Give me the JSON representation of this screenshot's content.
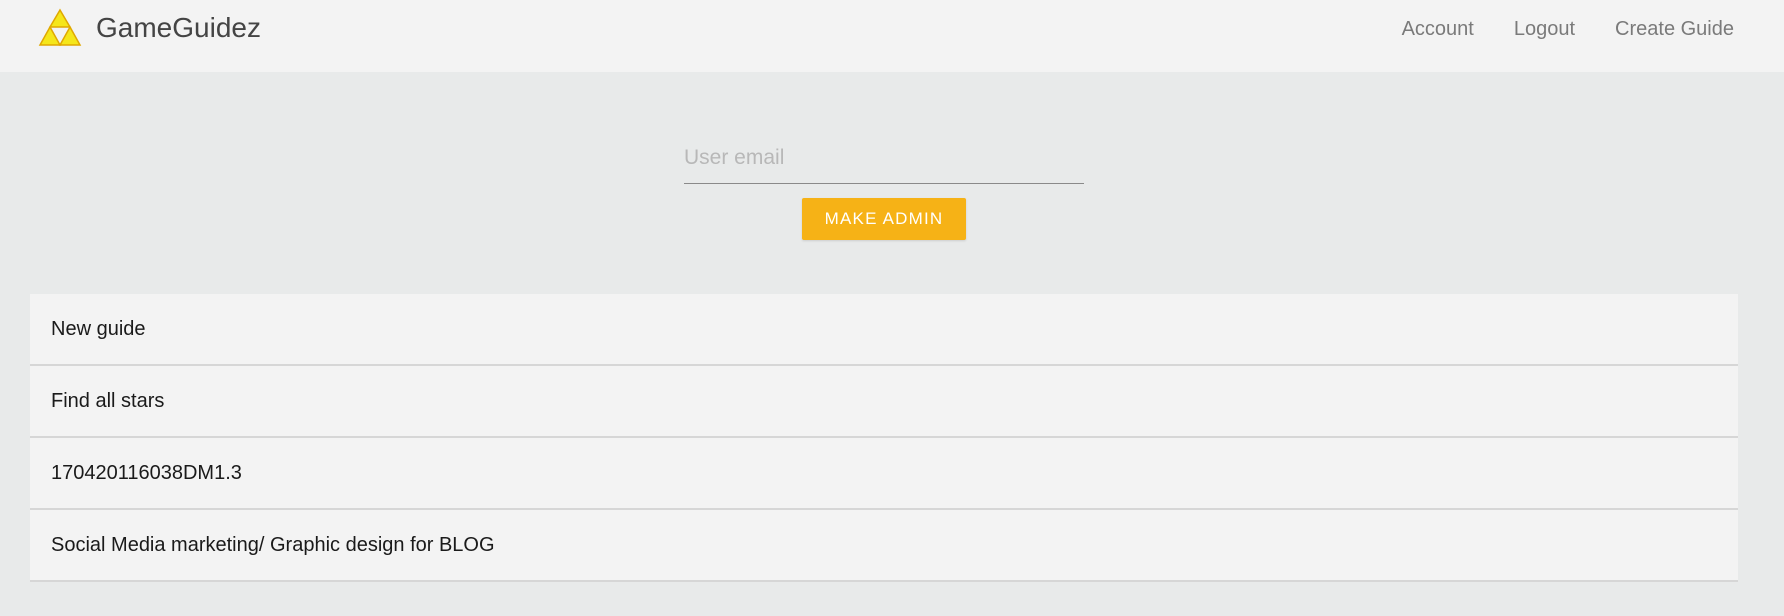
{
  "brand": {
    "name": "GameGuidez",
    "logo_icon": "triforce-icon",
    "logo_color": "#f5e61a"
  },
  "nav": {
    "items": [
      {
        "label": "Account"
      },
      {
        "label": "Logout"
      },
      {
        "label": "Create Guide"
      }
    ]
  },
  "admin_form": {
    "email_placeholder": "User email",
    "email_value": "",
    "submit_label": "MAKE ADMIN",
    "accent_color": "#f6b216"
  },
  "guides": [
    {
      "title": "New guide"
    },
    {
      "title": "Find all stars"
    },
    {
      "title": "170420116038DM1.3"
    },
    {
      "title": "Social Media marketing/ Graphic design for BLOG"
    }
  ]
}
